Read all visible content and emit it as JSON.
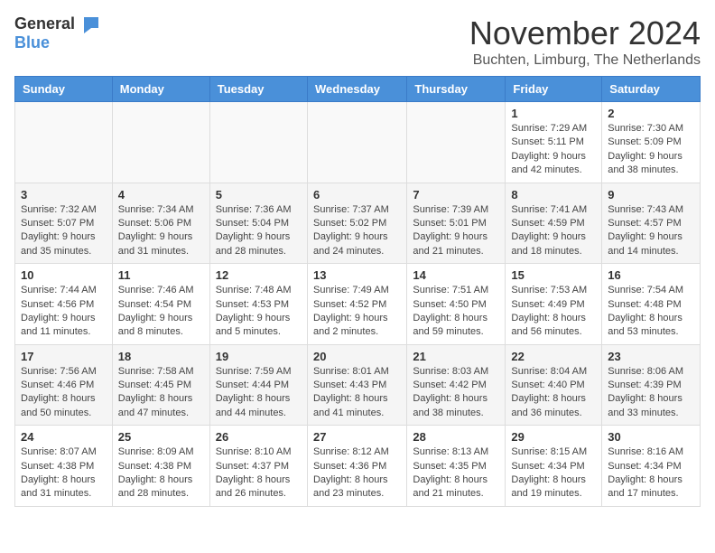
{
  "logo": {
    "general": "General",
    "blue": "Blue"
  },
  "title": "November 2024",
  "location": "Buchten, Limburg, The Netherlands",
  "days_of_week": [
    "Sunday",
    "Monday",
    "Tuesday",
    "Wednesday",
    "Thursday",
    "Friday",
    "Saturday"
  ],
  "weeks": [
    [
      {
        "day": "",
        "info": ""
      },
      {
        "day": "",
        "info": ""
      },
      {
        "day": "",
        "info": ""
      },
      {
        "day": "",
        "info": ""
      },
      {
        "day": "",
        "info": ""
      },
      {
        "day": "1",
        "info": "Sunrise: 7:29 AM\nSunset: 5:11 PM\nDaylight: 9 hours and 42 minutes."
      },
      {
        "day": "2",
        "info": "Sunrise: 7:30 AM\nSunset: 5:09 PM\nDaylight: 9 hours and 38 minutes."
      }
    ],
    [
      {
        "day": "3",
        "info": "Sunrise: 7:32 AM\nSunset: 5:07 PM\nDaylight: 9 hours and 35 minutes."
      },
      {
        "day": "4",
        "info": "Sunrise: 7:34 AM\nSunset: 5:06 PM\nDaylight: 9 hours and 31 minutes."
      },
      {
        "day": "5",
        "info": "Sunrise: 7:36 AM\nSunset: 5:04 PM\nDaylight: 9 hours and 28 minutes."
      },
      {
        "day": "6",
        "info": "Sunrise: 7:37 AM\nSunset: 5:02 PM\nDaylight: 9 hours and 24 minutes."
      },
      {
        "day": "7",
        "info": "Sunrise: 7:39 AM\nSunset: 5:01 PM\nDaylight: 9 hours and 21 minutes."
      },
      {
        "day": "8",
        "info": "Sunrise: 7:41 AM\nSunset: 4:59 PM\nDaylight: 9 hours and 18 minutes."
      },
      {
        "day": "9",
        "info": "Sunrise: 7:43 AM\nSunset: 4:57 PM\nDaylight: 9 hours and 14 minutes."
      }
    ],
    [
      {
        "day": "10",
        "info": "Sunrise: 7:44 AM\nSunset: 4:56 PM\nDaylight: 9 hours and 11 minutes."
      },
      {
        "day": "11",
        "info": "Sunrise: 7:46 AM\nSunset: 4:54 PM\nDaylight: 9 hours and 8 minutes."
      },
      {
        "day": "12",
        "info": "Sunrise: 7:48 AM\nSunset: 4:53 PM\nDaylight: 9 hours and 5 minutes."
      },
      {
        "day": "13",
        "info": "Sunrise: 7:49 AM\nSunset: 4:52 PM\nDaylight: 9 hours and 2 minutes."
      },
      {
        "day": "14",
        "info": "Sunrise: 7:51 AM\nSunset: 4:50 PM\nDaylight: 8 hours and 59 minutes."
      },
      {
        "day": "15",
        "info": "Sunrise: 7:53 AM\nSunset: 4:49 PM\nDaylight: 8 hours and 56 minutes."
      },
      {
        "day": "16",
        "info": "Sunrise: 7:54 AM\nSunset: 4:48 PM\nDaylight: 8 hours and 53 minutes."
      }
    ],
    [
      {
        "day": "17",
        "info": "Sunrise: 7:56 AM\nSunset: 4:46 PM\nDaylight: 8 hours and 50 minutes."
      },
      {
        "day": "18",
        "info": "Sunrise: 7:58 AM\nSunset: 4:45 PM\nDaylight: 8 hours and 47 minutes."
      },
      {
        "day": "19",
        "info": "Sunrise: 7:59 AM\nSunset: 4:44 PM\nDaylight: 8 hours and 44 minutes."
      },
      {
        "day": "20",
        "info": "Sunrise: 8:01 AM\nSunset: 4:43 PM\nDaylight: 8 hours and 41 minutes."
      },
      {
        "day": "21",
        "info": "Sunrise: 8:03 AM\nSunset: 4:42 PM\nDaylight: 8 hours and 38 minutes."
      },
      {
        "day": "22",
        "info": "Sunrise: 8:04 AM\nSunset: 4:40 PM\nDaylight: 8 hours and 36 minutes."
      },
      {
        "day": "23",
        "info": "Sunrise: 8:06 AM\nSunset: 4:39 PM\nDaylight: 8 hours and 33 minutes."
      }
    ],
    [
      {
        "day": "24",
        "info": "Sunrise: 8:07 AM\nSunset: 4:38 PM\nDaylight: 8 hours and 31 minutes."
      },
      {
        "day": "25",
        "info": "Sunrise: 8:09 AM\nSunset: 4:38 PM\nDaylight: 8 hours and 28 minutes."
      },
      {
        "day": "26",
        "info": "Sunrise: 8:10 AM\nSunset: 4:37 PM\nDaylight: 8 hours and 26 minutes."
      },
      {
        "day": "27",
        "info": "Sunrise: 8:12 AM\nSunset: 4:36 PM\nDaylight: 8 hours and 23 minutes."
      },
      {
        "day": "28",
        "info": "Sunrise: 8:13 AM\nSunset: 4:35 PM\nDaylight: 8 hours and 21 minutes."
      },
      {
        "day": "29",
        "info": "Sunrise: 8:15 AM\nSunset: 4:34 PM\nDaylight: 8 hours and 19 minutes."
      },
      {
        "day": "30",
        "info": "Sunrise: 8:16 AM\nSunset: 4:34 PM\nDaylight: 8 hours and 17 minutes."
      }
    ]
  ]
}
